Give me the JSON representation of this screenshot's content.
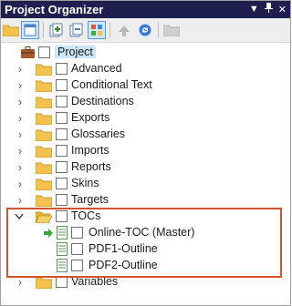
{
  "window": {
    "title": "Project Organizer"
  },
  "tree": {
    "root": {
      "label": "Project"
    },
    "folders": [
      {
        "label": "Advanced"
      },
      {
        "label": "Conditional Text"
      },
      {
        "label": "Destinations"
      },
      {
        "label": "Exports"
      },
      {
        "label": "Glossaries"
      },
      {
        "label": "Imports"
      },
      {
        "label": "Reports"
      },
      {
        "label": "Skins"
      },
      {
        "label": "Targets"
      },
      {
        "label": "TOCs",
        "expanded": true
      },
      {
        "label": "Variables"
      }
    ],
    "toc_children": [
      {
        "label": "Online-TOC (Master)",
        "master": true
      },
      {
        "label": "PDF1-Outline"
      },
      {
        "label": "PDF2-Outline"
      }
    ]
  },
  "colors": {
    "titlebar": "#1f1f4f",
    "highlight": "#d2532f",
    "folder": "#f2c14e"
  }
}
